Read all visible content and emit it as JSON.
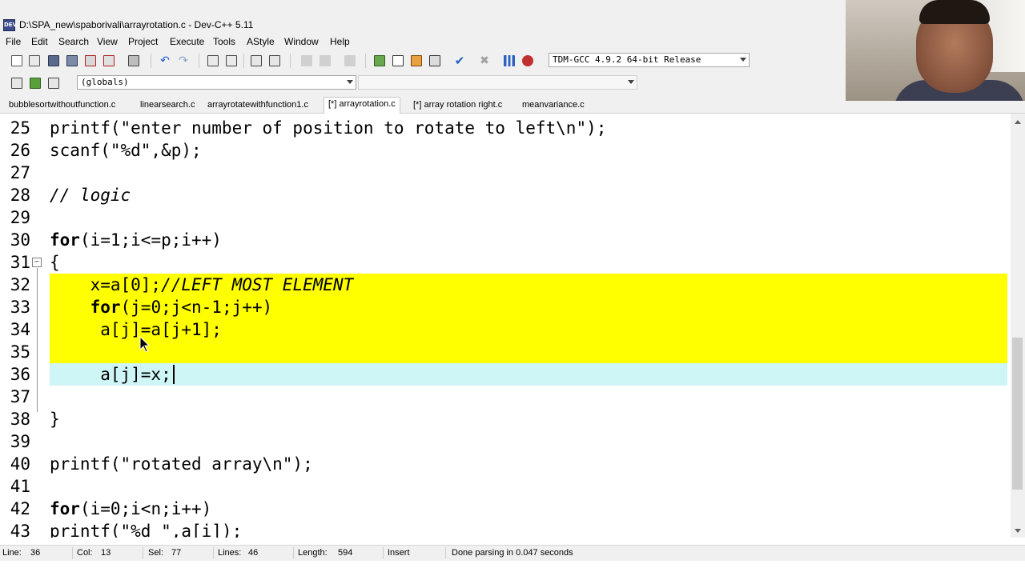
{
  "window": {
    "title": "D:\\SPA_new\\spaborivali\\arrayrotation.c - Dev-C++ 5.11",
    "app_icon_text": "DEV"
  },
  "menu": [
    "File",
    "Edit",
    "Search",
    "View",
    "Project",
    "Execute",
    "Tools",
    "AStyle",
    "Window",
    "Help"
  ],
  "toolbar": {
    "compiler": "TDM-GCC 4.9.2 64-bit Release",
    "scope": "(globals)",
    "function": ""
  },
  "tabs": [
    {
      "label": "bubblesortwithoutfunction.c",
      "active": false
    },
    {
      "label": "linearsearch.c",
      "active": false
    },
    {
      "label": "arrayrotatewithfunction1.c",
      "active": false
    },
    {
      "label": "[*] arrayrotation.c",
      "active": true
    },
    {
      "label": "[*] array rotation right.c",
      "active": false
    },
    {
      "label": "meanvariance.c",
      "active": false
    }
  ],
  "editor": {
    "lines": [
      {
        "num": "25",
        "text": "printf(\"enter number of position to rotate to left\\n\");"
      },
      {
        "num": "26",
        "text": "scanf(\"%d\",&p);"
      },
      {
        "num": "27",
        "text": ""
      },
      {
        "num": "28",
        "text": "// logic"
      },
      {
        "num": "29",
        "text": ""
      },
      {
        "num": "30",
        "text": "for(i=1;i<=p;i++)"
      },
      {
        "num": "31",
        "text": "{"
      },
      {
        "num": "32",
        "text": "    x=a[0];//LEFT MOST ELEMENT"
      },
      {
        "num": "33",
        "text": "    for(j=0;j<n-1;j++)"
      },
      {
        "num": "34",
        "text": "     a[j]=a[j+1];"
      },
      {
        "num": "35",
        "text": ""
      },
      {
        "num": "36",
        "text": "     a[j]=x;"
      },
      {
        "num": "37",
        "text": ""
      },
      {
        "num": "38",
        "text": "}"
      },
      {
        "num": "39",
        "text": ""
      },
      {
        "num": "40",
        "text": "printf(\"rotated array\\n\");"
      },
      {
        "num": "41",
        "text": ""
      },
      {
        "num": "42",
        "text": "for(i=0;i<n;i++)"
      },
      {
        "num": "43",
        "text": "printf(\"%d \",a[i]);"
      }
    ],
    "fold_marker": "−"
  },
  "status": {
    "line_label": "Line:",
    "line_value": "36",
    "col_label": "Col:",
    "col_value": "13",
    "sel_label": "Sel:",
    "sel_value": "77",
    "lines_label": "Lines:",
    "lines_value": "46",
    "length_label": "Length:",
    "length_value": "594",
    "mode": "Insert",
    "message": "Done parsing in 0.047 seconds"
  },
  "colors": {
    "selection": "#ffff00",
    "current_line": "#cff6f6",
    "chrome": "#f0f0f0"
  }
}
